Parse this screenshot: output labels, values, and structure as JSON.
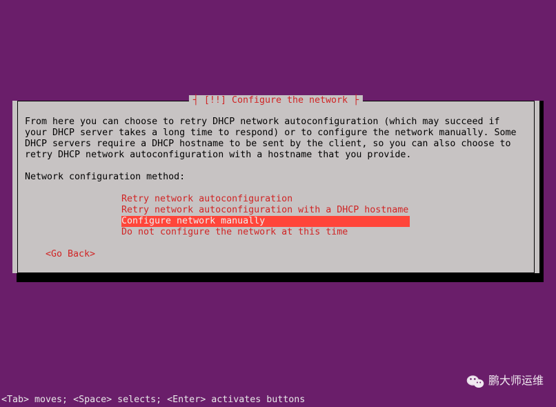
{
  "dialog": {
    "title": "┤ [!!] Configure the network ├",
    "description": "From here you can choose to retry DHCP network autoconfiguration (which may succeed if\nyour DHCP server takes a long time to respond) or to configure the network manually. Some\nDHCP servers require a DHCP hostname to be sent by the client, so you can also choose to\nretry DHCP network autoconfiguration with a hostname that you provide.",
    "prompt": "Network configuration method:",
    "options": [
      {
        "label": "Retry network autoconfiguration",
        "selected": false
      },
      {
        "label": "Retry network autoconfiguration with a DHCP hostname",
        "selected": false
      },
      {
        "label": "Configure network manually",
        "selected": true
      },
      {
        "label": "Do not configure the network at this time",
        "selected": false
      }
    ],
    "go_back": "<Go Back>"
  },
  "footer_hint": "<Tab> moves; <Space> selects; <Enter> activates buttons",
  "watermark": {
    "text": "鹏大师运维"
  }
}
